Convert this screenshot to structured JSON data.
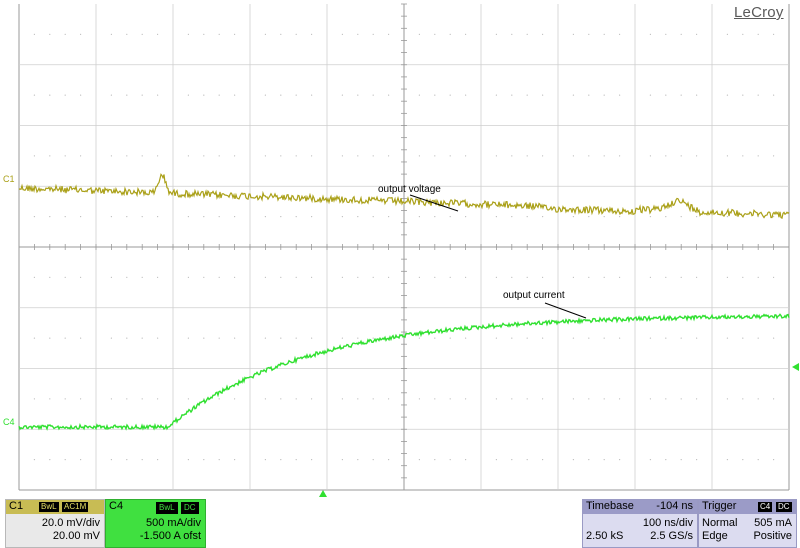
{
  "brand": "LeCroy",
  "channels": {
    "c1": {
      "label": "C1",
      "color": "#aaa018"
    },
    "c4": {
      "label": "C4",
      "color": "#30e030"
    }
  },
  "annotations": {
    "voltage": "output voltage",
    "current": "output current"
  },
  "panels": {
    "c1": {
      "name": "C1",
      "tag1": "BwL",
      "tag2": "AC1M",
      "scale": "20.0 mV/div",
      "offset": "20.00 mV"
    },
    "c4": {
      "name": "C4",
      "tag1": "BwL",
      "tag2": "DC",
      "scale": "500 mA/div",
      "offset": "-1.500 A ofst"
    },
    "timebase": {
      "title": "Timebase",
      "delay": "-104 ns",
      "scale": "100 ns/div",
      "samples": "2.50 kS",
      "rate": "2.5 GS/s"
    },
    "trigger": {
      "title": "Trigger",
      "src": "C4",
      "coupling": "DC",
      "mode": "Normal",
      "level": "505 mA",
      "type": "Edge",
      "slope": "Positive"
    }
  }
}
